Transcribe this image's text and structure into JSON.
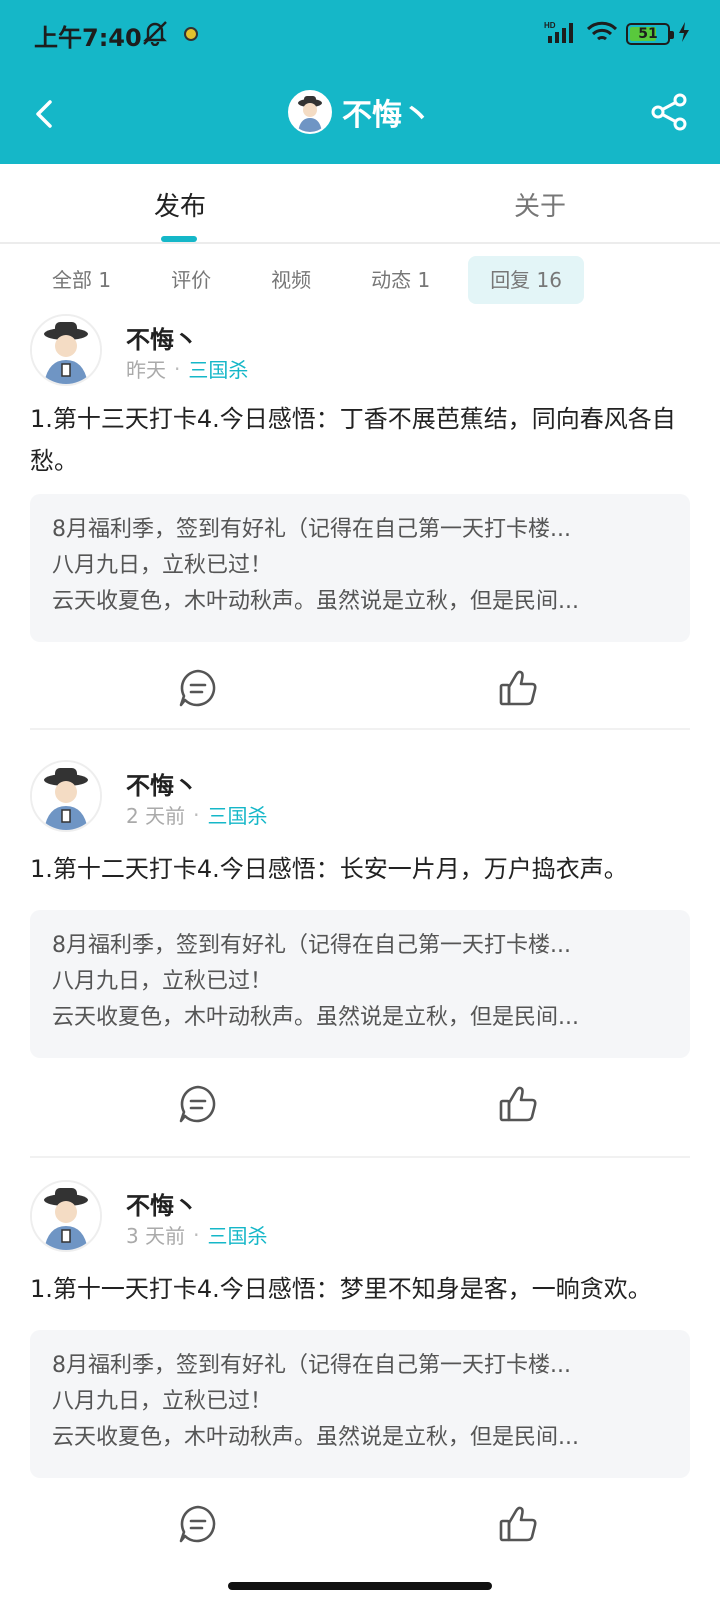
{
  "status_bar": {
    "time": "上午7:40",
    "battery": "51",
    "icons": [
      "mute-icon",
      "notification-dot-icon",
      "signal-icon",
      "wifi-icon",
      "battery-icon",
      "charging-icon"
    ]
  },
  "header": {
    "title": "不悔丶",
    "colors": {
      "brand": "#15b7c8"
    }
  },
  "tabs": [
    {
      "label": "发布",
      "active": true
    },
    {
      "label": "关于",
      "active": false
    }
  ],
  "filters": [
    {
      "label": "全部 1",
      "active": false
    },
    {
      "label": "评价",
      "active": false
    },
    {
      "label": "视频",
      "active": false
    },
    {
      "label": "动态 1",
      "active": false
    },
    {
      "label": "回复 16",
      "active": true
    }
  ],
  "posts": [
    {
      "author": "不悔丶",
      "time": "昨天",
      "separator": "·",
      "forum": "三国杀",
      "content": "1.第十三天打卡4.今日感悟：丁香不展芭蕉结，同向春风各自愁。",
      "quote_line1": "8月福利季，签到有好礼（记得在自己第一天打卡楼...",
      "quote_line2": "八月九日，立秋已过！",
      "quote_line3": "云天收夏色，木叶动秋声。虽然说是立秋，但是民间..."
    },
    {
      "author": "不悔丶",
      "time": "2 天前",
      "separator": "·",
      "forum": "三国杀",
      "content": "1.第十二天打卡4.今日感悟：长安一片月，万户捣衣声。",
      "quote_line1": "8月福利季，签到有好礼（记得在自己第一天打卡楼...",
      "quote_line2": "八月九日，立秋已过！",
      "quote_line3": "云天收夏色，木叶动秋声。虽然说是立秋，但是民间..."
    },
    {
      "author": "不悔丶",
      "time": "3 天前",
      "separator": "·",
      "forum": "三国杀",
      "content": "1.第十一天打卡4.今日感悟：梦里不知身是客，一晌贪欢。",
      "quote_line1": "8月福利季，签到有好礼（记得在自己第一天打卡楼...",
      "quote_line2": "八月九日，立秋已过！",
      "quote_line3": "云天收夏色，木叶动秋声。虽然说是立秋，但是民间..."
    }
  ]
}
